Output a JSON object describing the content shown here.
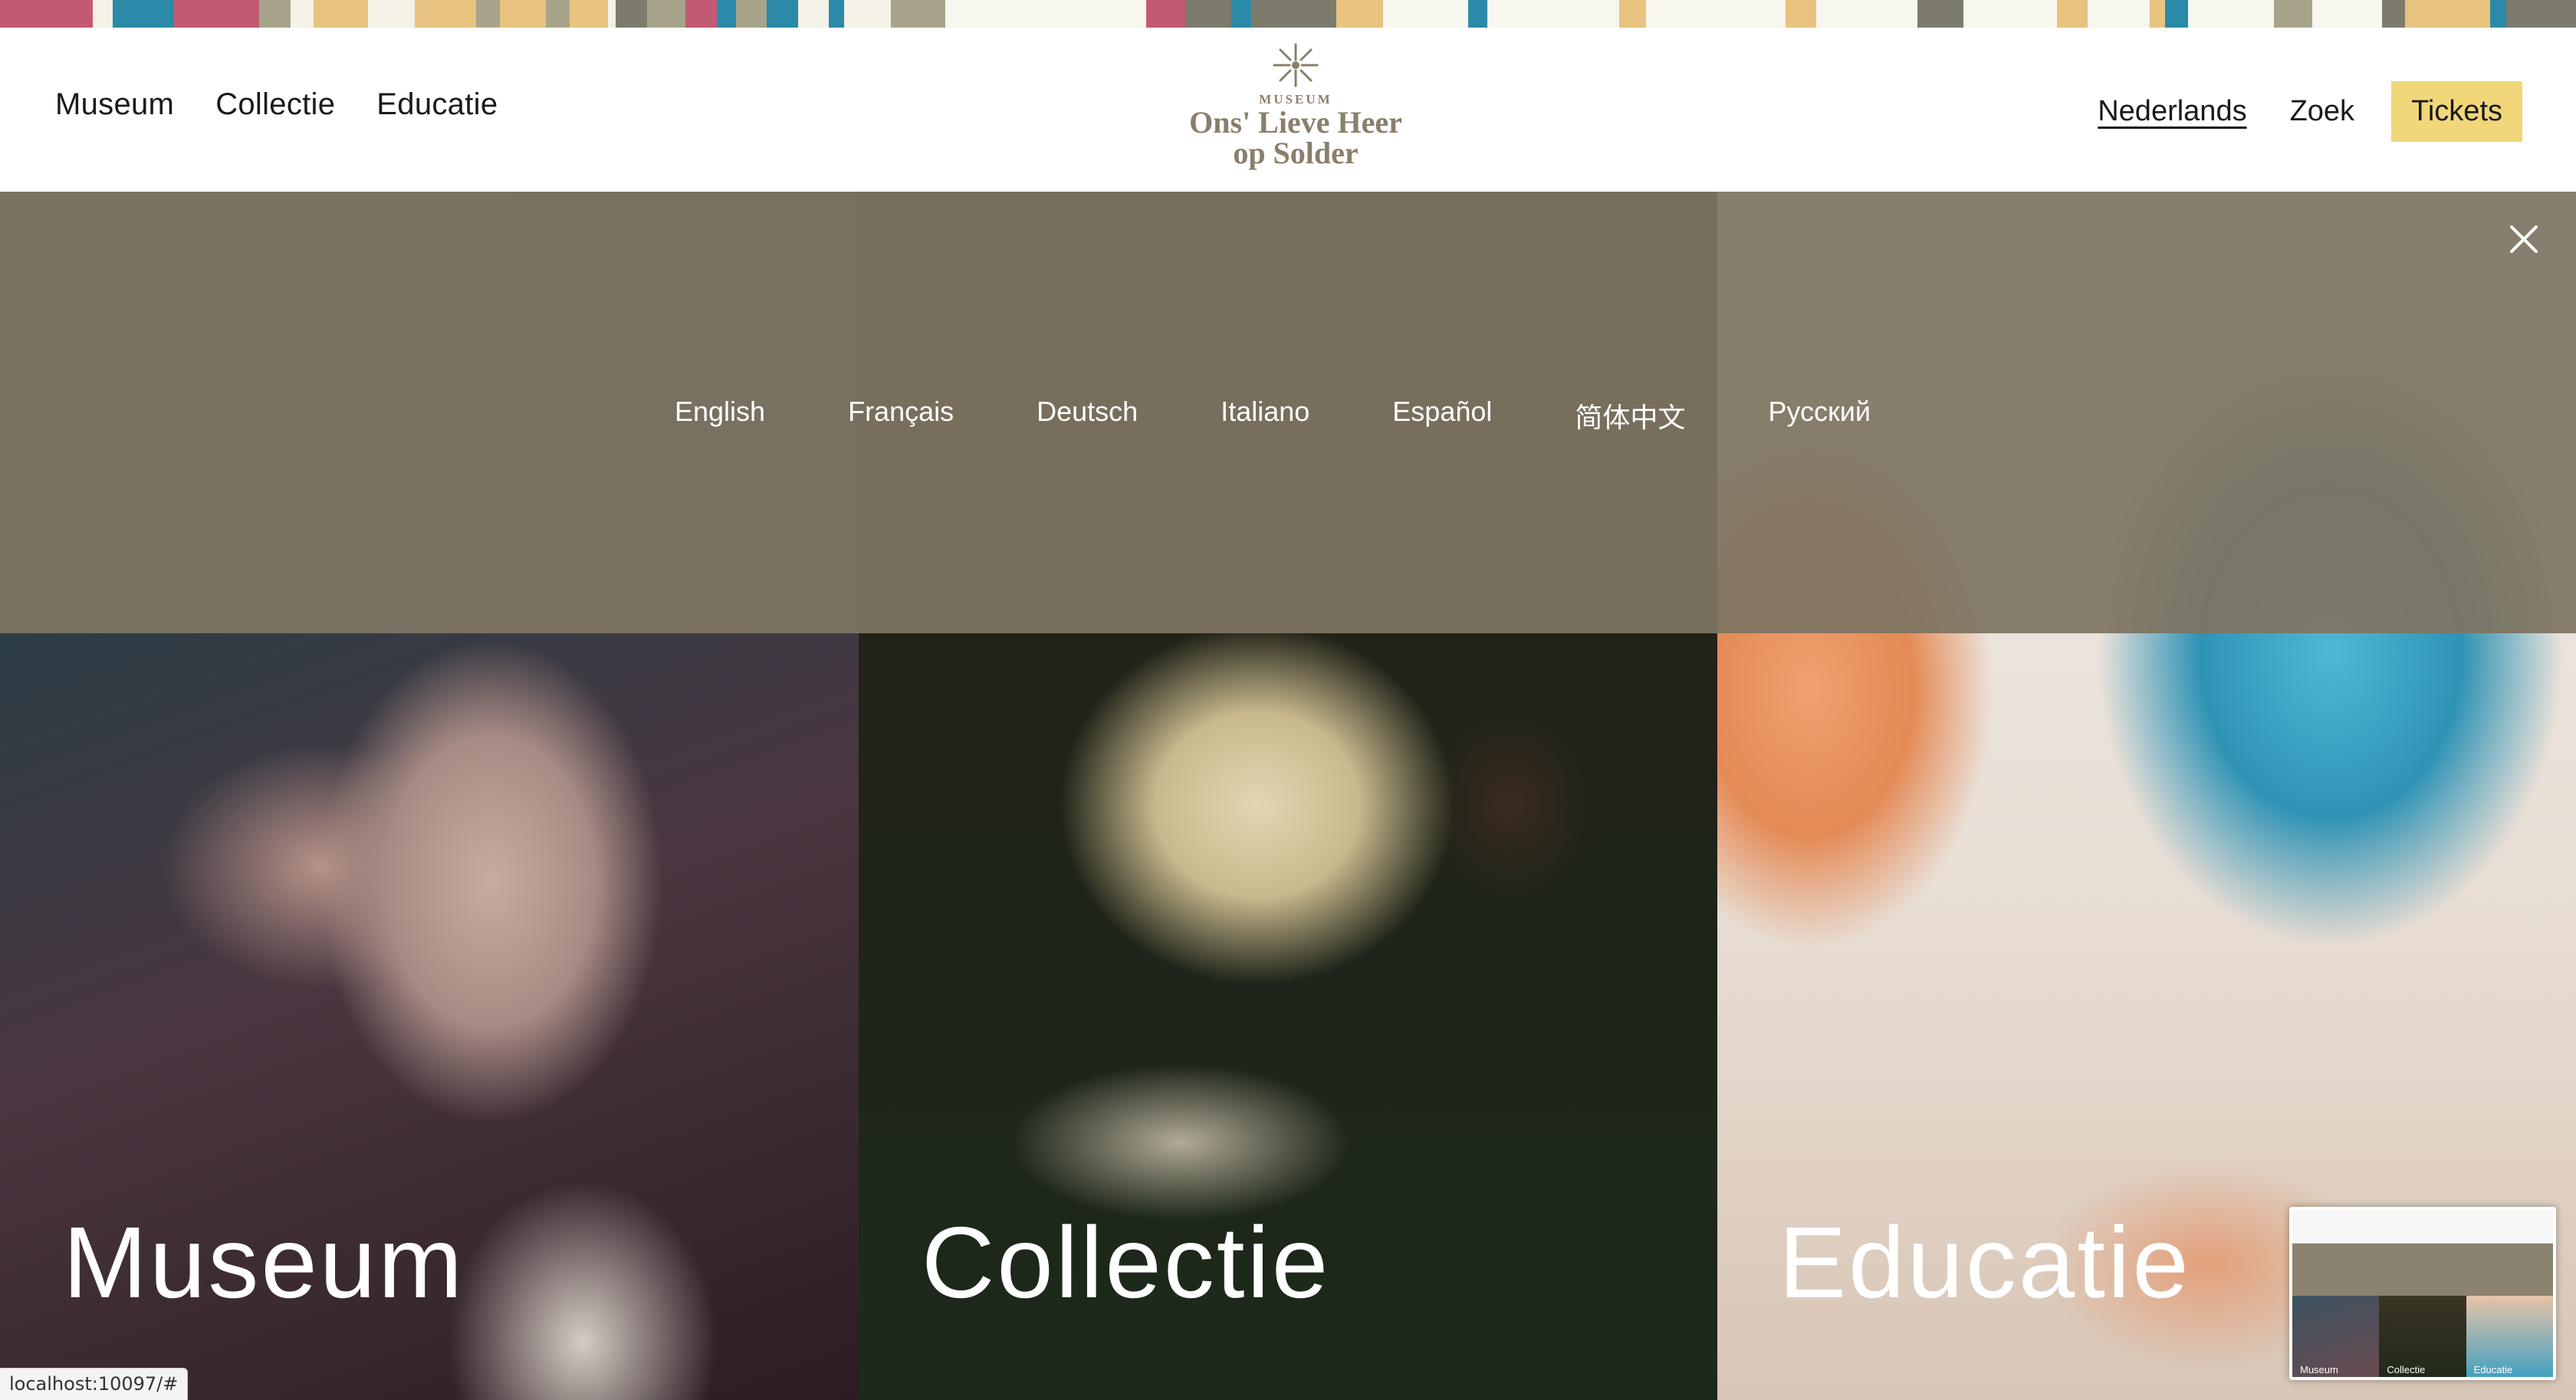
{
  "stripe": {
    "colors": [
      "#c35a74",
      "#f4f1e6",
      "#2a8aa8",
      "#c35a74",
      "#a7a48a",
      "#f4f1e6",
      "#e7c37f",
      "#f4f1e6",
      "#e7c37f",
      "#a7a48a",
      "#e7c37f",
      "#a7a48a",
      "#e7c37f",
      "#f4f1e6",
      "#7d7b6c",
      "#a7a48a",
      "#c35a74",
      "#2a8aa8",
      "#a7a48a",
      "#2a8aa8",
      "#f4f1e6",
      "#2a8aa8",
      "#f4f1e6",
      "#a7a48a",
      "#f7f6ef",
      "#c35a74",
      "#7d7b6c",
      "#2a8aa8",
      "#7d7b6c",
      "#e7c37f",
      "#f7f6ef",
      "#2a8aa8",
      "#f7f6ef",
      "#e7c37f",
      "#f7f6ef",
      "#e7c37f",
      "#f7f6ef",
      "#7d7b6c",
      "#f7f6ef",
      "#e7c37f",
      "#f7f6ef",
      "#e7c37f",
      "#2a8aa8",
      "#f7f6ef",
      "#a7a48a",
      "#f7f6ef",
      "#7d7b6c",
      "#e7c37f",
      "#2a8aa8",
      "#7d7b6c"
    ],
    "widths": [
      120,
      25,
      80,
      110,
      40,
      30,
      70,
      60,
      80,
      30,
      60,
      30,
      50,
      10,
      40,
      50,
      40,
      25,
      40,
      40,
      40,
      20,
      60,
      70,
      260,
      50,
      60,
      25,
      110,
      60,
      110,
      25,
      170,
      35,
      180,
      40,
      130,
      60,
      120,
      40,
      80,
      20,
      30,
      110,
      50,
      90,
      30,
      110,
      20,
      90
    ]
  },
  "header": {
    "nav": [
      "Museum",
      "Collectie",
      "Educatie"
    ],
    "logo": {
      "small": "MUSEUM",
      "line1": "Ons' Lieve Heer",
      "line2": "op Solder"
    },
    "language": "Nederlands",
    "search": "Zoek",
    "tickets": "Tickets"
  },
  "language_overlay": {
    "languages": [
      "English",
      "Français",
      "Deutsch",
      "Italiano",
      "Español",
      "简体中文",
      "Русский"
    ],
    "close_icon": "close-icon"
  },
  "panels": [
    {
      "title": "Museum"
    },
    {
      "title": "Collectie"
    },
    {
      "title": "Educatie"
    }
  ],
  "status_bar": "localhost:10097/#",
  "thumbnail": {
    "labels": [
      "Museum",
      "Collectie",
      "Educatie"
    ]
  },
  "colors": {
    "tickets_bg": "#f1d77a",
    "overlay": "#7e7462",
    "logo": "#8a7f6c"
  }
}
